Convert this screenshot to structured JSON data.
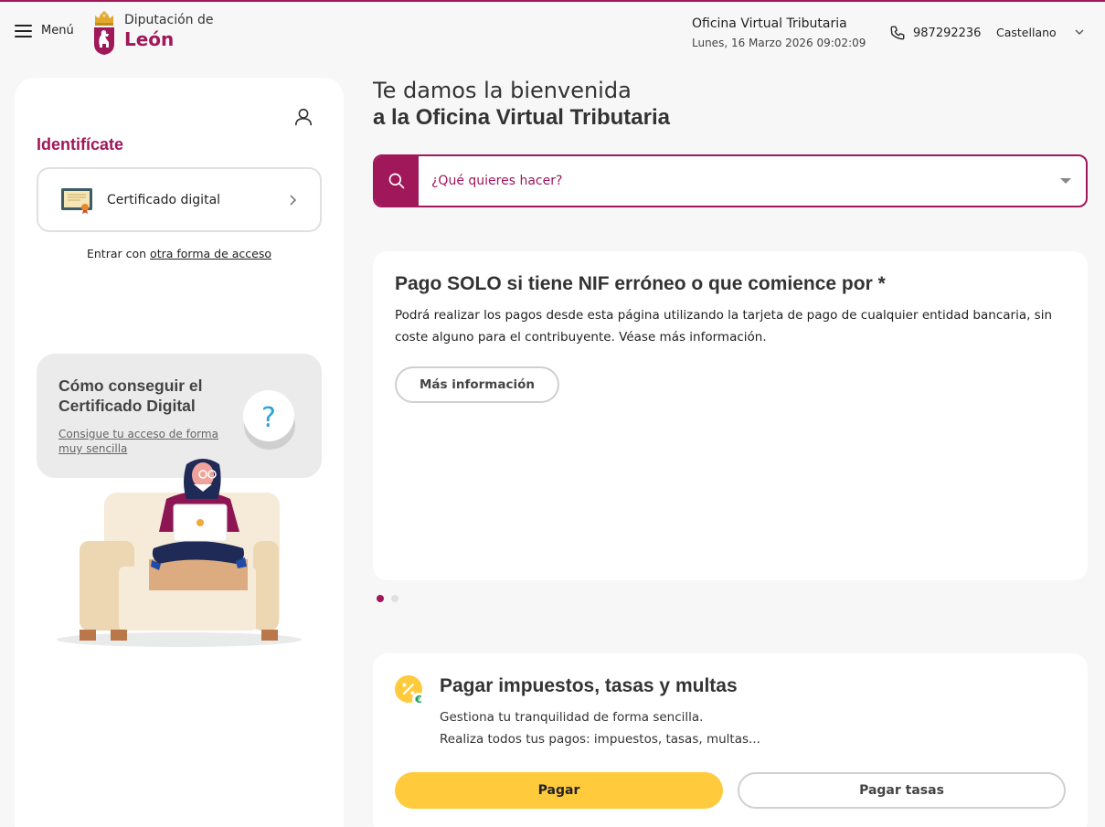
{
  "header": {
    "menu_label": "Menú",
    "logo_line1": "Diputación de",
    "logo_line2": "León",
    "office_title": "Oficina Virtual Tributaria",
    "office_datetime": "Lunes, 16 Marzo 2026 09:02:09",
    "phone": "987292236",
    "language": "Castellano"
  },
  "login": {
    "title": "Identifícate",
    "certificate_button": "Certificado digital",
    "alt_access_prefix": "Entrar con ",
    "alt_access_link": "otra forma de acceso"
  },
  "help_card": {
    "title": "Cómo conseguir el Certificado Digital",
    "link": "Consigue tu acceso de forma muy sencilla",
    "icon_glyph": "?"
  },
  "main": {
    "welcome_line1": "Te damos la bienvenida",
    "welcome_line2": "a la Oficina Virtual Tributaria",
    "search_placeholder": "¿Qué quieres hacer?"
  },
  "banner": {
    "title": "Pago SOLO si tiene NIF erróneo o que comience por *",
    "text": "Podrá realizar los pagos desde esta página utilizando la tarjeta de pago de cualquier entidad bancaria, sin coste alguno para el contribuyente. Véase más información.",
    "button": "Más información",
    "slides": 2,
    "active_slide": 1
  },
  "pay_card": {
    "title": "Pagar impuestos, tasas y multas",
    "line1": "Gestiona tu tranquilidad de forma sencilla.",
    "line2": "Realiza todos tus pagos: impuestos, tasas, multas...",
    "primary_button": "Pagar",
    "secondary_button": "Pagar tasas"
  },
  "colors": {
    "brand": "#a0175a",
    "accent_yellow": "#ffcb3d",
    "background": "#f7f7f7"
  },
  "icons": [
    "menu-icon",
    "crown-shield-logo",
    "phone-icon",
    "chevron-down-icon",
    "user-icon",
    "certificate-icon",
    "chevron-right-icon",
    "question-icon",
    "search-icon",
    "percent-euro-icon"
  ]
}
